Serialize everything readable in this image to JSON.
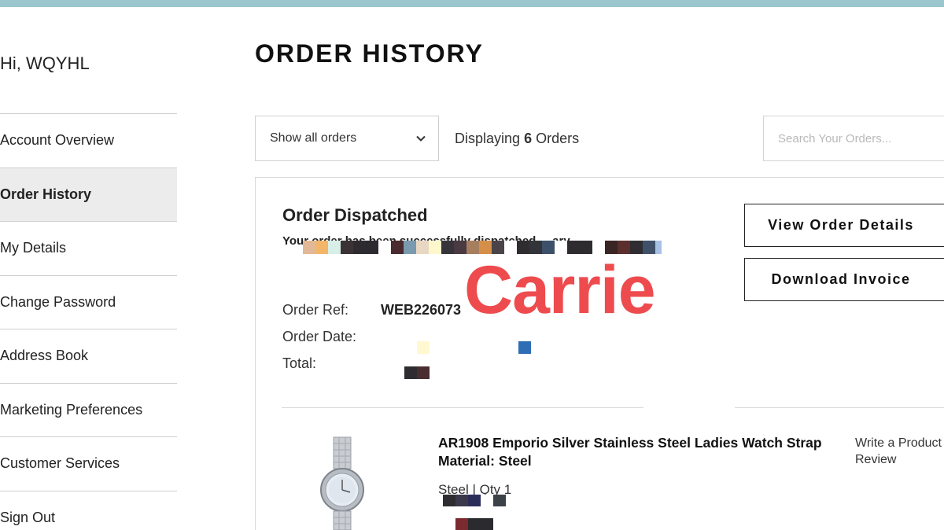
{
  "account": {
    "greeting": "Hi, WQYHL"
  },
  "sidebar": {
    "items": [
      {
        "label": "Account Overview"
      },
      {
        "label": "Order History"
      },
      {
        "label": "My Details"
      },
      {
        "label": "Change Password"
      },
      {
        "label": "Address Book"
      },
      {
        "label": "Marketing Preferences"
      },
      {
        "label": "Customer Services"
      },
      {
        "label": "Sign Out"
      }
    ],
    "active_index": 1
  },
  "main": {
    "title": "ORDER HISTORY",
    "filter": {
      "selected": "Show all orders"
    },
    "display": {
      "prefix": "Displaying",
      "count": "6",
      "suffix": "Orders"
    },
    "search": {
      "placeholder": "Search Your Orders..."
    }
  },
  "order": {
    "status": "Order Dispatched",
    "status_message": "Your order has been successfully dispatched ... ary",
    "overlay_text": "Carrie",
    "ref_label": "Order Ref:",
    "ref_value": "WEB226073",
    "date_label": "Order Date:",
    "total_label": "Total:",
    "buttons": {
      "view_details": "View Order Details",
      "download_invoice": "Download Invoice"
    },
    "item": {
      "title": "AR1908 Emporio Silver Stainless Steel Ladies Watch Strap Material: Steel",
      "variant": "Steel | Qty 1",
      "review_link": "Write a Product Review"
    }
  },
  "colors": {
    "top_strip": "#9cc6cd",
    "active_sidebar_bg": "#ececec",
    "overlay_text": "#ee4b4f",
    "border": "#cfcfcf"
  }
}
